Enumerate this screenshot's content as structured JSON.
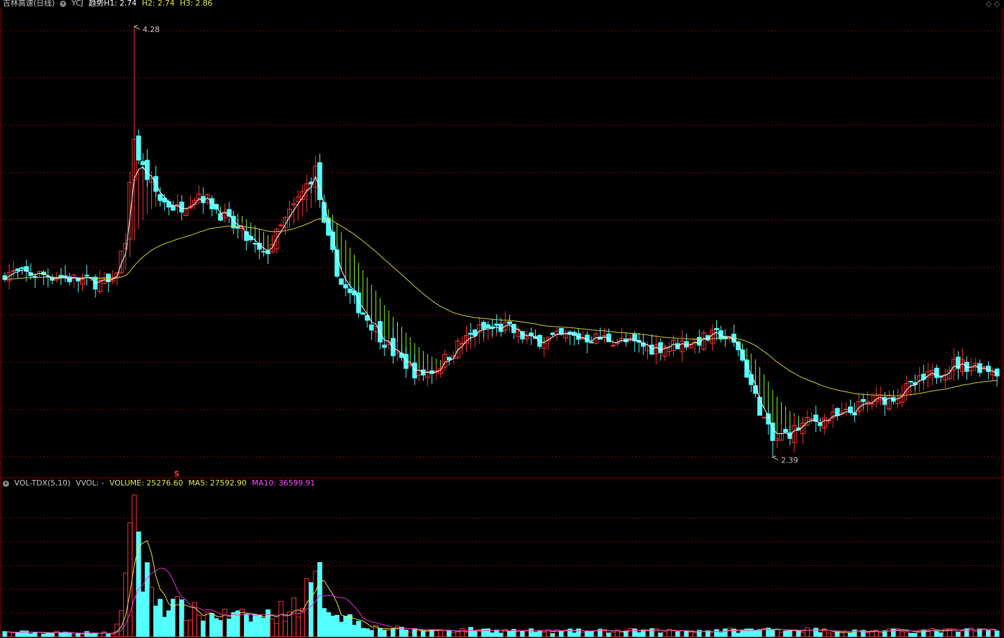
{
  "header": {
    "stock_title": "吉林高速(日线)",
    "indicator_name": "YCJ",
    "trend_label": "趋势H1: 2.74",
    "h2_label": "H2: 2.74",
    "h3_label": "H3: 2.86",
    "corner_icons": "◇ ◇"
  },
  "volume_header": {
    "name": "VOL-TDX(5,10)",
    "vvol": "VVOL: -",
    "volume": "VOLUME: 25276.60",
    "ma5": "MA5: 27592.90",
    "ma10": "MA10: 36599.91"
  },
  "marker_symbol": "S",
  "colors": {
    "up": "#ff3232",
    "down": "#54ffff",
    "grid": "#8b0000",
    "ma_long": "#d4d430",
    "ribbon_up": "#ff3c3c",
    "ribbon_down": "#8cff32",
    "vol_ma5": "#e6e650",
    "vol_ma10": "#e632e6",
    "label_white": "#ffffff",
    "label_yellow": "#e6e650",
    "label_magenta": "#ff4cff"
  },
  "chart_data": {
    "type": "candlestick",
    "price_annotations": [
      {
        "label": "4.28",
        "value": 4.28
      },
      {
        "label": "2.39",
        "value": 2.39
      }
    ],
    "ylim": [
      2.3,
      4.36
    ],
    "volume_ylim": [
      0,
      62000
    ],
    "keypoints_close": [
      [
        0,
        3.2
      ],
      [
        10,
        3.19
      ],
      [
        20,
        3.16
      ],
      [
        25,
        3.15
      ],
      [
        28,
        3.35
      ],
      [
        30,
        3.8
      ],
      [
        31,
        3.7
      ],
      [
        33,
        3.62
      ],
      [
        36,
        3.52
      ],
      [
        40,
        3.48
      ],
      [
        45,
        3.55
      ],
      [
        48,
        3.5
      ],
      [
        52,
        3.42
      ],
      [
        56,
        3.35
      ],
      [
        60,
        3.27
      ],
      [
        65,
        3.43
      ],
      [
        69,
        3.55
      ],
      [
        72,
        3.65
      ],
      [
        74,
        3.4
      ],
      [
        78,
        3.15
      ],
      [
        82,
        3.05
      ],
      [
        86,
        2.95
      ],
      [
        90,
        2.85
      ],
      [
        96,
        2.75
      ],
      [
        100,
        2.78
      ],
      [
        105,
        2.88
      ],
      [
        110,
        2.95
      ],
      [
        116,
        2.96
      ],
      [
        122,
        2.9
      ],
      [
        130,
        2.92
      ],
      [
        140,
        2.91
      ],
      [
        150,
        2.87
      ],
      [
        160,
        2.9
      ],
      [
        166,
        2.93
      ],
      [
        170,
        2.87
      ],
      [
        174,
        2.65
      ],
      [
        178,
        2.46
      ],
      [
        182,
        2.5
      ],
      [
        187,
        2.55
      ],
      [
        194,
        2.57
      ],
      [
        200,
        2.63
      ],
      [
        206,
        2.66
      ],
      [
        212,
        2.72
      ],
      [
        220,
        2.8
      ],
      [
        226,
        2.79
      ],
      [
        230,
        2.77
      ]
    ],
    "keypoints_volume": [
      [
        0,
        1800
      ],
      [
        25,
        1500
      ],
      [
        26,
        4500
      ],
      [
        27,
        8000
      ],
      [
        28,
        20000
      ],
      [
        29,
        52000
      ],
      [
        30,
        60000
      ],
      [
        31,
        40000
      ],
      [
        32,
        26000
      ],
      [
        34,
        21000
      ],
      [
        36,
        15000
      ],
      [
        40,
        12000
      ],
      [
        44,
        10000
      ],
      [
        50,
        9000
      ],
      [
        56,
        8000
      ],
      [
        62,
        9000
      ],
      [
        68,
        14000
      ],
      [
        71,
        20000
      ],
      [
        73,
        23000
      ],
      [
        75,
        13000
      ],
      [
        80,
        7500
      ],
      [
        86,
        3800
      ],
      [
        95,
        2600
      ],
      [
        110,
        2800
      ],
      [
        125,
        2200
      ],
      [
        150,
        2400
      ],
      [
        172,
        2600
      ],
      [
        180,
        3200
      ],
      [
        195,
        2200
      ],
      [
        210,
        2400
      ],
      [
        230,
        2600
      ]
    ],
    "ribbon_fast": "EMA of close, span 3",
    "ribbon_slow": "EMA of close, span 13",
    "ma_long": "EMA of close, span 45"
  }
}
